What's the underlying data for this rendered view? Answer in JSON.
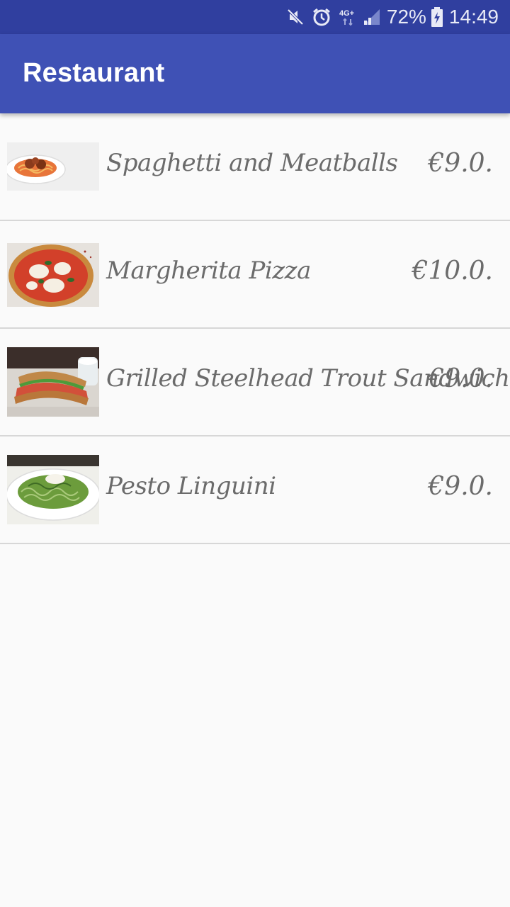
{
  "status_bar": {
    "battery": "72%",
    "time": "14:49",
    "network": "4G+",
    "icons": [
      "mute-icon",
      "alarm-icon",
      "network-4g-icon",
      "signal-icon",
      "battery-charging-icon"
    ]
  },
  "app_bar": {
    "title": "Restaurant",
    "color": "#3f51b5",
    "status_color": "#303f9f"
  },
  "menu": {
    "items": [
      {
        "name": "Spaghetti and Meatballs",
        "price": "€9.0.",
        "image": "spaghetti-meatballs-photo"
      },
      {
        "name": "Margherita Pizza",
        "price": "€10.0.",
        "image": "margherita-pizza-photo"
      },
      {
        "name": "Grilled Steelhead Trout Sandwich",
        "price": "€9.0.",
        "image": "trout-sandwich-photo"
      },
      {
        "name": "Pesto Linguini",
        "price": "€9.0.",
        "image": "pesto-linguini-photo"
      }
    ]
  }
}
